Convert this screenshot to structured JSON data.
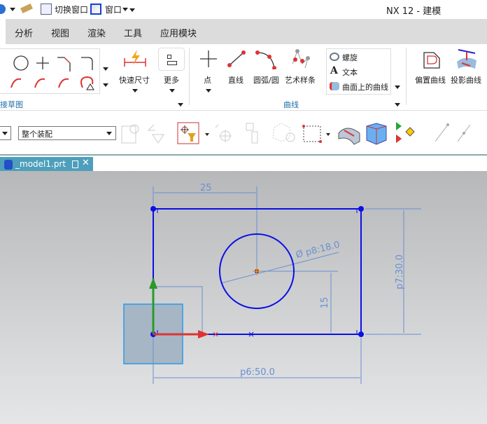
{
  "quick_access": {
    "switch_window": "切换窗口",
    "window": "窗口"
  },
  "app_title": "NX 12 - 建模",
  "menu": [
    "分析",
    "视图",
    "渲染",
    "工具",
    "应用模块"
  ],
  "ribbon": {
    "sketch_group": "接草图",
    "quick_dimension": "快速尺寸",
    "more": "更多",
    "point": "点",
    "line": "直线",
    "arc_circle": "圆弧/圆",
    "studio_spline": "艺术样条",
    "helix": "螺旋",
    "text": "文本",
    "curve_on_surface": "曲面上的曲线",
    "curve_group": "曲线",
    "offset_curve": "偏置曲线",
    "project_curve": "投影曲线"
  },
  "toolbar": {
    "selection_scope": "整个装配"
  },
  "document_tab": {
    "name": "_model1.prt"
  },
  "sketch": {
    "dim_horizontal": "25",
    "dim_vertical_15": "15",
    "dim_width": "p6:50.0",
    "dim_height": "p7:30.0",
    "dim_diameter": "Ø p8:18.0"
  },
  "colors": {
    "sketch": "#0a10e6",
    "dimension": "#5a7fc8",
    "tab": "#4e9fbb"
  }
}
